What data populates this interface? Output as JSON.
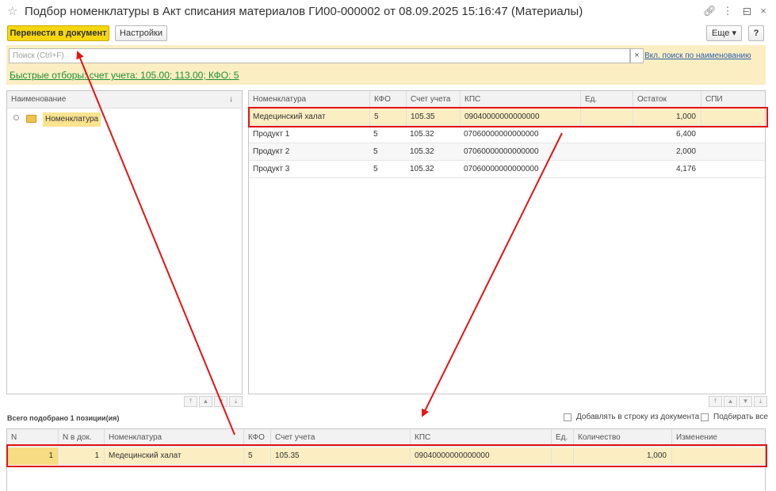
{
  "window": {
    "title": "Подбор номенклатуры в Акт списания материалов ГИ00-000002 от 08.09.2025 15:16:47 (Материалы)"
  },
  "toolbar": {
    "transfer_label": "Перенести в документ",
    "settings_label": "Настройки",
    "more_label": "Еще",
    "help_label": "?"
  },
  "search": {
    "placeholder": "Поиск (Ctrl+F)",
    "clear_glyph": "×",
    "link_label": "Вкл. поиск по наименованию"
  },
  "quick_filter": "Быстрые отборы: счет учета: 105.00; 113.00; КФО: 5",
  "tree": {
    "header": "Наименование",
    "sort_glyph": "↓",
    "node_label": "Номенклатура"
  },
  "items": {
    "columns": [
      "Номенклатура",
      "КФО",
      "Счет учета",
      "КПС",
      "Ед.",
      "Остаток",
      "СПИ"
    ],
    "rows": [
      {
        "name": "Медецинский халат",
        "kfo": "5",
        "account": "105.35",
        "kps": "09040000000000000",
        "unit": "",
        "rest": "1,000",
        "spi": ""
      },
      {
        "name": "Продукт 1",
        "kfo": "5",
        "account": "105.32",
        "kps": "07060000000000000",
        "unit": "",
        "rest": "6,400",
        "spi": ""
      },
      {
        "name": "Продукт 2",
        "kfo": "5",
        "account": "105.32",
        "kps": "07060000000000000",
        "unit": "",
        "rest": "2,000",
        "spi": ""
      },
      {
        "name": "Продукт 3",
        "kfo": "5",
        "account": "105.32",
        "kps": "07060000000000000",
        "unit": "",
        "rest": "4,176",
        "spi": ""
      }
    ]
  },
  "selected": {
    "total_label": "Всего подобрано 1 позиции(ия)",
    "add_row_label": "Добавлять в строку из документа",
    "pick_all_label": "Подбирать все",
    "columns": [
      "N",
      "N в док.",
      "Номенклатура",
      "КФО",
      "Счет учета",
      "КПС",
      "Ед.",
      "Количество",
      "Изменение"
    ],
    "rows": [
      {
        "n": "1",
        "n_doc": "1",
        "name": "Медецинский халат",
        "kfo": "5",
        "account": "105.35",
        "kps": "09040000000000000",
        "unit": "",
        "qty": "1,000",
        "change": ""
      }
    ]
  },
  "icons": {
    "star": "star-icon",
    "link": "link-icon",
    "menu": "more-vertical-icon",
    "minimize": "minimize-icon",
    "maximize": "maximize-icon",
    "close": "close-icon",
    "folder": "folder-icon"
  },
  "colors": {
    "primary_button": "#f5d60f",
    "selection": "#fbeec2",
    "quick_filter": "#1f8e3a",
    "annotation": "#e31414"
  }
}
